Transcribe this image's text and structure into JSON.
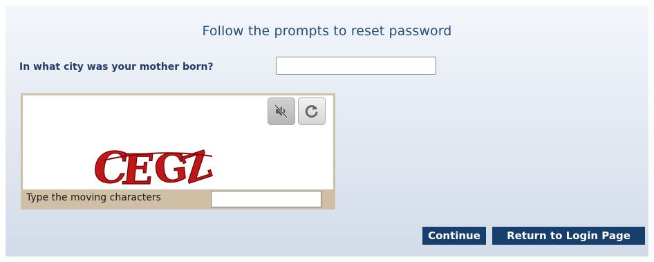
{
  "header": {
    "title": "Follow the prompts to reset password"
  },
  "security_question": {
    "label": "In what city was your mother born?",
    "value": "",
    "placeholder": ""
  },
  "captcha": {
    "characters": "CEGZ",
    "audio_icon": "speaker-muted-icon",
    "refresh_icon": "refresh-icon",
    "input_label": "Type the moving characters",
    "input_value": ""
  },
  "actions": {
    "continue_label": "Continue",
    "return_label": "Return to Login Page"
  },
  "colors": {
    "title": "#264c7a",
    "button_bg": "#16406b",
    "captcha_frame": "#cfc0a5",
    "captcha_text": "#c01818"
  }
}
